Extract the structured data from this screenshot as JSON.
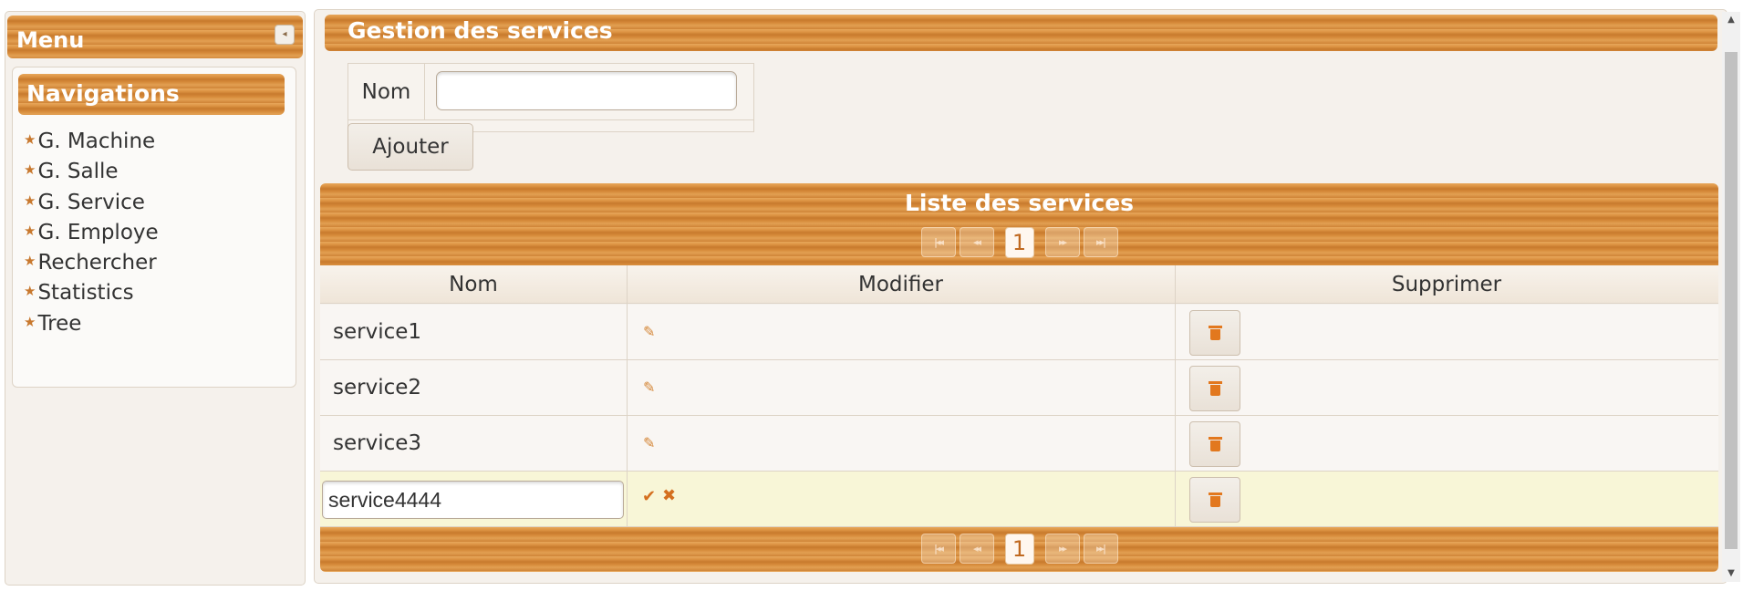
{
  "sidebar": {
    "menu_title": "Menu",
    "collapse_glyph": "◂",
    "nav_title": "Navigations",
    "star_glyph": "★",
    "items": [
      {
        "label": "G. Machine"
      },
      {
        "label": "G. Salle"
      },
      {
        "label": "G. Service"
      },
      {
        "label": "G. Employe"
      },
      {
        "label": "Rechercher"
      },
      {
        "label": "Statistics"
      },
      {
        "label": "Tree"
      }
    ]
  },
  "form": {
    "title": "Gestion des services",
    "nom_label": "Nom",
    "nom_value": "",
    "add_label": "Ajouter"
  },
  "table": {
    "title": "Liste des services",
    "paginator": {
      "first": "|◂◂",
      "prev": "◂◂",
      "page": "1",
      "next": "▸▸",
      "last": "▸▸|"
    },
    "columns": [
      "Nom",
      "Modifier",
      "Supprimer"
    ],
    "rows": [
      {
        "name": "service1"
      },
      {
        "name": "service2"
      },
      {
        "name": "service3"
      }
    ],
    "editing_row": {
      "value": "service4444",
      "ok_glyph": "✔",
      "cancel_glyph": "✖"
    },
    "edit_glyph": "✎"
  },
  "colors": {
    "accent": "#d68a3a",
    "edit_row_bg": "#f8f6d7",
    "icon": "#e2781e"
  }
}
